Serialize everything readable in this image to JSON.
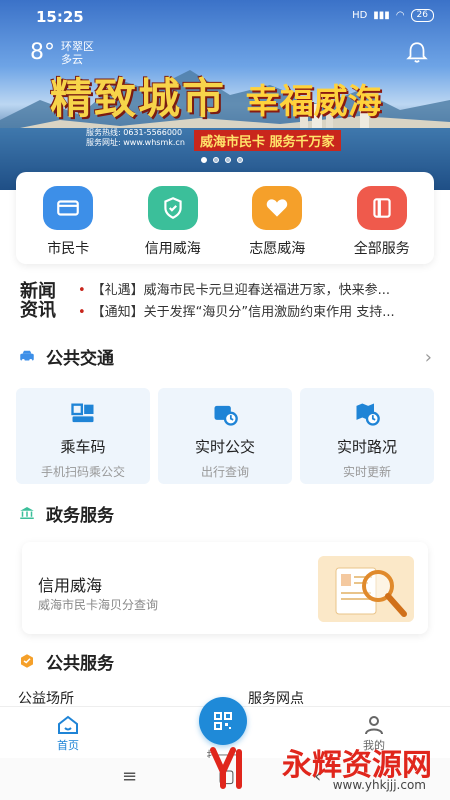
{
  "status": {
    "time": "15:25",
    "network": "HD",
    "battery": "26"
  },
  "weather": {
    "temp": "8°",
    "district": "环翠区",
    "condition": "多云"
  },
  "banner": {
    "slogan_1": "精致城市",
    "slogan_2": "幸福威海",
    "hotline_1": "服务热线: 0631-5566000",
    "hotline_2": "服务网址: www.whsmk.cn",
    "tagline": "威海市民卡 服务千万家"
  },
  "quick_services": [
    {
      "label": "市民卡",
      "icon": "card-icon",
      "color": "#3d8fe8"
    },
    {
      "label": "信用威海",
      "icon": "shield-check-icon",
      "color": "#3bbf9a"
    },
    {
      "label": "志愿威海",
      "icon": "heart-icon",
      "color": "#f5a02a"
    },
    {
      "label": "全部服务",
      "icon": "book-icon",
      "color": "#ef5a4c"
    }
  ],
  "news": {
    "title": "新闻资讯",
    "items": [
      "【礼遇】威海市民卡元旦迎春送福进万家，快来参...",
      "【通知】关于发挥“海贝分”信用激励约束作用 支持..."
    ]
  },
  "public_transport": {
    "title": "公共交通",
    "tiles": [
      {
        "title": "乘车码",
        "subtitle": "手机扫码乘公交",
        "icon": "bus-code-icon"
      },
      {
        "title": "实时公交",
        "subtitle": "出行查询",
        "icon": "bus-clock-icon"
      },
      {
        "title": "实时路况",
        "subtitle": "实时更新",
        "icon": "map-clock-icon"
      }
    ]
  },
  "gov_services": {
    "title": "政务服务",
    "card_title": "信用威海",
    "card_subtitle": "威海市民卡海贝分查询"
  },
  "public_services": {
    "title": "公共服务",
    "items": [
      "公益场所",
      "服务网点"
    ]
  },
  "tabbar": {
    "home": "首页",
    "scan": "扫一扫",
    "mine": "我的"
  },
  "watermark": {
    "text": "永辉资源网",
    "url": "www.yhkjjj.com"
  },
  "colors": {
    "accent": "#1f84d6",
    "news_bullet": "#c8261c"
  }
}
